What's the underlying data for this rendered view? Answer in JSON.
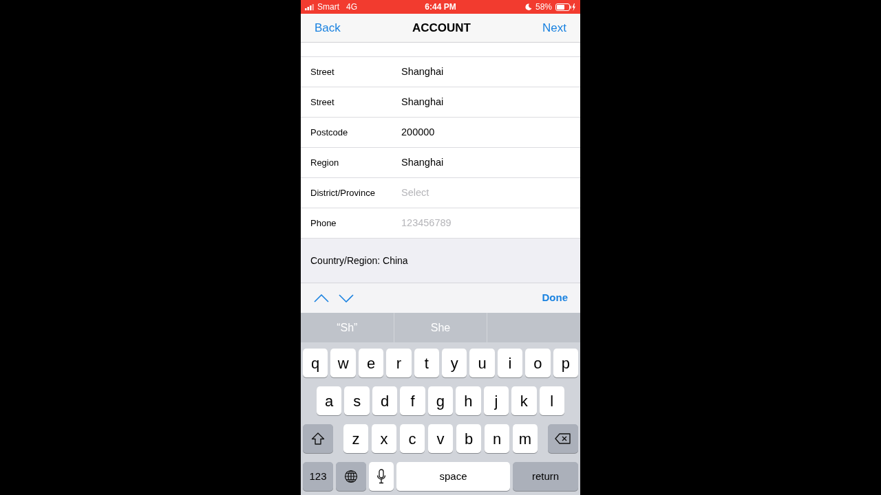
{
  "status_bar": {
    "carrier": "Smart",
    "network": "4G",
    "time": "6:44 PM",
    "battery": "58%"
  },
  "nav": {
    "back": "Back",
    "title": "ACCOUNT",
    "next": "Next"
  },
  "rows": [
    {
      "label": "Street",
      "value": "Shanghai"
    },
    {
      "label": "Street",
      "value": "Shanghai"
    },
    {
      "label": "Postcode",
      "value": "200000"
    },
    {
      "label": "Region",
      "value": "Shanghai"
    },
    {
      "label": "District/Province",
      "placeholder": "Select"
    },
    {
      "label": "Phone",
      "placeholder": "123456789"
    }
  ],
  "footer": "Country/Region: China",
  "toolbar": {
    "done": "Done"
  },
  "suggestions": [
    "“Sh”",
    "She"
  ],
  "keyboard": [
    [
      {
        "kind": "letter",
        "label": "q"
      },
      {
        "kind": "letter",
        "label": "w"
      },
      {
        "kind": "letter",
        "label": "e"
      },
      {
        "kind": "letter",
        "label": "r"
      },
      {
        "kind": "letter",
        "label": "t"
      },
      {
        "kind": "letter",
        "label": "y"
      },
      {
        "kind": "letter",
        "label": "u"
      },
      {
        "kind": "letter",
        "label": "i"
      },
      {
        "kind": "letter",
        "label": "o"
      },
      {
        "kind": "letter",
        "label": "p"
      }
    ],
    [
      {
        "kind": "letter",
        "label": "a"
      },
      {
        "kind": "letter",
        "label": "s"
      },
      {
        "kind": "letter",
        "label": "d"
      },
      {
        "kind": "letter",
        "label": "f"
      },
      {
        "kind": "letter",
        "label": "g"
      },
      {
        "kind": "letter",
        "label": "h"
      },
      {
        "kind": "letter",
        "label": "j"
      },
      {
        "kind": "letter",
        "label": "k"
      },
      {
        "kind": "letter",
        "label": "l"
      }
    ],
    [
      {
        "kind": "shift"
      },
      {
        "kind": "letter",
        "label": "z"
      },
      {
        "kind": "letter",
        "label": "x"
      },
      {
        "kind": "letter",
        "label": "c"
      },
      {
        "kind": "letter",
        "label": "v"
      },
      {
        "kind": "letter",
        "label": "b"
      },
      {
        "kind": "letter",
        "label": "n"
      },
      {
        "kind": "letter",
        "label": "m"
      },
      {
        "kind": "delete"
      }
    ],
    [
      {
        "kind": "mode",
        "label": "123"
      },
      {
        "kind": "globe"
      },
      {
        "kind": "mic"
      },
      {
        "kind": "space",
        "label": "space"
      },
      {
        "kind": "return",
        "label": "return"
      }
    ]
  ]
}
